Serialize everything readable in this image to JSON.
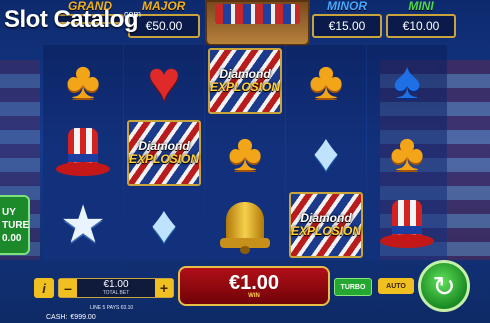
{
  "watermark": "Slot Catalog",
  "watermark_suffix": "com",
  "jackpots": [
    {
      "label": "GRAND",
      "value": "",
      "label_color": "#f2b21c"
    },
    {
      "label": "MAJOR",
      "value": "€50.00",
      "label_color": "#f2b21c"
    },
    {
      "label": "MINOR",
      "value": "€15.00",
      "label_color": "#4aa8ff"
    },
    {
      "label": "MINI",
      "value": "€10.00",
      "label_color": "#54d84a"
    }
  ],
  "buy_feature": {
    "line1": "UY",
    "line2": "TURE",
    "line3": "0.00"
  },
  "reels": [
    [
      "club",
      "hat",
      "star"
    ],
    [
      "heart",
      "wild",
      "diamond"
    ],
    [
      "wild",
      "club",
      "bell"
    ],
    [
      "club",
      "diamond",
      "wild"
    ],
    [
      "spade",
      "club",
      "hat"
    ]
  ],
  "wild_text": {
    "line1": "Diamond",
    "line2": "EXPLOSION"
  },
  "bottom_bar": {
    "info_label": "i",
    "minus_label": "–",
    "plus_label": "+",
    "bet_value": "€1.00",
    "bet_label": "TOTAL BET",
    "win_value": "€1.00",
    "win_label": "WIN",
    "turbo_label": "TURBO",
    "auto_label": "AUTO",
    "spin_icon": "↻",
    "pays_line": "LINE 5 PAYS €0.10",
    "cash_label": "CASH:",
    "cash_value": "€999.00"
  }
}
